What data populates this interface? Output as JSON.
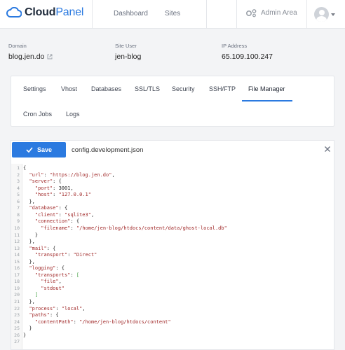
{
  "brand": {
    "name_bold": "Cloud",
    "name_accent": "Panel"
  },
  "nav": {
    "dashboard": "Dashboard",
    "sites": "Sites",
    "admin": "Admin Area"
  },
  "site_info": {
    "domain_label": "Domain",
    "domain_value": "blog.jen.do",
    "user_label": "Site User",
    "user_value": "jen-blog",
    "ip_label": "IP Address",
    "ip_value": "65.109.100.247"
  },
  "tabs": [
    {
      "label": "Settings"
    },
    {
      "label": "Vhost"
    },
    {
      "label": "Databases"
    },
    {
      "label": "SSL/TLS"
    },
    {
      "label": "Security"
    },
    {
      "label": "SSH/FTP"
    },
    {
      "label": "File Manager",
      "active": true
    },
    {
      "label": "Cron Jobs"
    },
    {
      "label": "Logs"
    }
  ],
  "editor": {
    "save_label": "Save",
    "file_name": "config.development.json",
    "lines": [
      {
        "n": "1",
        "t": "{"
      },
      {
        "n": "2",
        "t": "  \"url\": \"https://blog.jen.do\","
      },
      {
        "n": "3",
        "t": "  \"server\": {"
      },
      {
        "n": "4",
        "t": "    \"port\": 3001,"
      },
      {
        "n": "5",
        "t": "    \"host\": \"127.0.0.1\""
      },
      {
        "n": "6",
        "t": "  },"
      },
      {
        "n": "7",
        "t": "  \"database\": {"
      },
      {
        "n": "8",
        "t": "    \"client\": \"sqlite3\","
      },
      {
        "n": "9",
        "t": "    \"connection\": {"
      },
      {
        "n": "10",
        "t": "      \"filename\": \"/home/jen-blog/htdocs/content/data/ghost-local.db\""
      },
      {
        "n": "11",
        "t": "    }"
      },
      {
        "n": "12",
        "t": "  },"
      },
      {
        "n": "13",
        "t": "  \"mail\": {"
      },
      {
        "n": "14",
        "t": "    \"transport\": \"Direct\""
      },
      {
        "n": "15",
        "t": "  },"
      },
      {
        "n": "16",
        "t": "  \"logging\": {"
      },
      {
        "n": "17",
        "t": "    \"transports\": ["
      },
      {
        "n": "18",
        "t": "      \"file\","
      },
      {
        "n": "19",
        "t": "      \"stdout\""
      },
      {
        "n": "20",
        "t": "    ]"
      },
      {
        "n": "21",
        "t": "  },"
      },
      {
        "n": "22",
        "t": "  \"process\": \"local\","
      },
      {
        "n": "23",
        "t": "  \"paths\": {"
      },
      {
        "n": "24",
        "t": "    \"contentPath\": \"/home/jen-blog/htdocs/content\""
      },
      {
        "n": "25",
        "t": "  }"
      },
      {
        "n": "26",
        "t": "}"
      },
      {
        "n": "27",
        "t": ""
      }
    ]
  },
  "colors": {
    "accent": "#2b7ae0",
    "json_string": "#a02828",
    "bracket_open": "#3a9a3a"
  }
}
